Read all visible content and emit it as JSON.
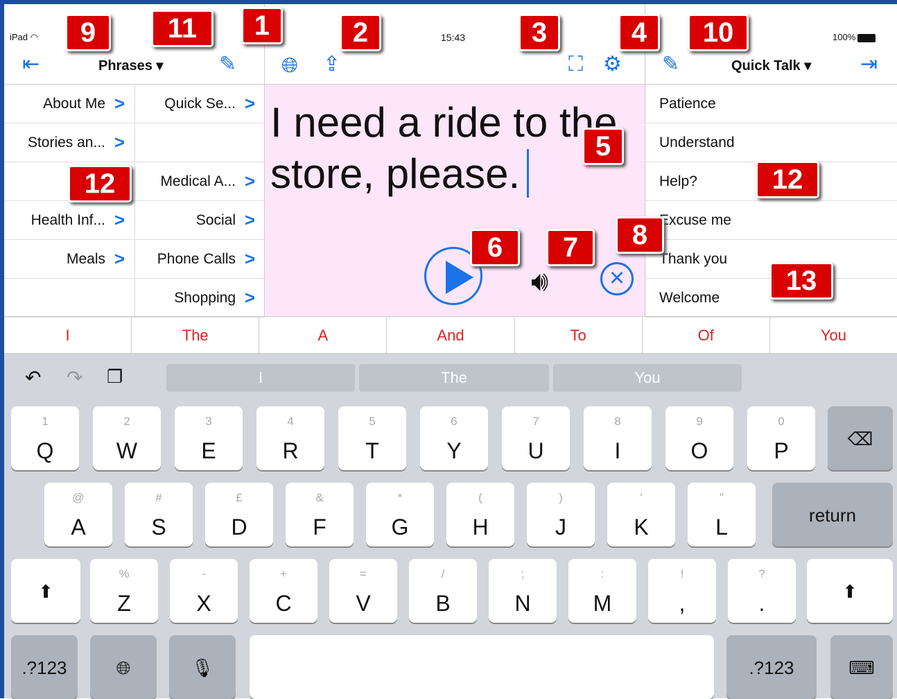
{
  "status": {
    "carrier": "iPad",
    "time": "15:43",
    "battery": "100%"
  },
  "left_panel": {
    "title": "Phrases ▾",
    "grid": [
      {
        "label": "About Me"
      },
      {
        "label": "Quick Se..."
      },
      {
        "label": "Stories an..."
      },
      {
        "label": ""
      },
      {
        "label": ""
      },
      {
        "label": "Medical A..."
      },
      {
        "label": "Health Inf..."
      },
      {
        "label": "Social"
      },
      {
        "label": "Meals"
      },
      {
        "label": "Phone Calls"
      },
      {
        "label": ""
      },
      {
        "label": "Shopping"
      }
    ]
  },
  "message": {
    "text": "I need a ride to the store,  please."
  },
  "right_panel": {
    "title": "Quick Talk ▾",
    "items": [
      "Patience",
      "Understand",
      "Help?",
      "Excuse me",
      "Thank you",
      "Welcome"
    ]
  },
  "predictions": [
    "I",
    "The",
    "A",
    "And",
    "To",
    "Of",
    "You"
  ],
  "keyboard": {
    "suggestions": [
      "I",
      "The",
      "You"
    ],
    "row1": [
      {
        "hint": "1",
        "label": "Q"
      },
      {
        "hint": "2",
        "label": "W"
      },
      {
        "hint": "3",
        "label": "E"
      },
      {
        "hint": "4",
        "label": "R"
      },
      {
        "hint": "5",
        "label": "T"
      },
      {
        "hint": "6",
        "label": "Y"
      },
      {
        "hint": "7",
        "label": "U"
      },
      {
        "hint": "8",
        "label": "I"
      },
      {
        "hint": "9",
        "label": "O"
      },
      {
        "hint": "0",
        "label": "P"
      }
    ],
    "row2": [
      {
        "hint": "@",
        "label": "A"
      },
      {
        "hint": "#",
        "label": "S"
      },
      {
        "hint": "£",
        "label": "D"
      },
      {
        "hint": "&",
        "label": "F"
      },
      {
        "hint": "*",
        "label": "G"
      },
      {
        "hint": "(",
        "label": "H"
      },
      {
        "hint": ")",
        "label": "J"
      },
      {
        "hint": "'",
        "label": "K"
      },
      {
        "hint": "\"",
        "label": "L"
      }
    ],
    "row3": [
      {
        "hint": "%",
        "label": "Z"
      },
      {
        "hint": "-",
        "label": "X"
      },
      {
        "hint": "+",
        "label": "C"
      },
      {
        "hint": "=",
        "label": "V"
      },
      {
        "hint": "/",
        "label": "B"
      },
      {
        "hint": ";",
        "label": "N"
      },
      {
        "hint": ":",
        "label": "M"
      },
      {
        "hint": "!",
        "label": ","
      },
      {
        "hint": "?",
        "label": "."
      }
    ],
    "return_label": "return",
    "numbers_label": ".?123"
  },
  "annotations": [
    "1",
    "2",
    "3",
    "4",
    "5",
    "6",
    "7",
    "8",
    "9",
    "10",
    "11",
    "12",
    "12",
    "13"
  ],
  "colors": {
    "accent": "#1a73e8",
    "message_bg": "#fde6f9",
    "prediction": "#e02020",
    "badge": "#d80000"
  }
}
